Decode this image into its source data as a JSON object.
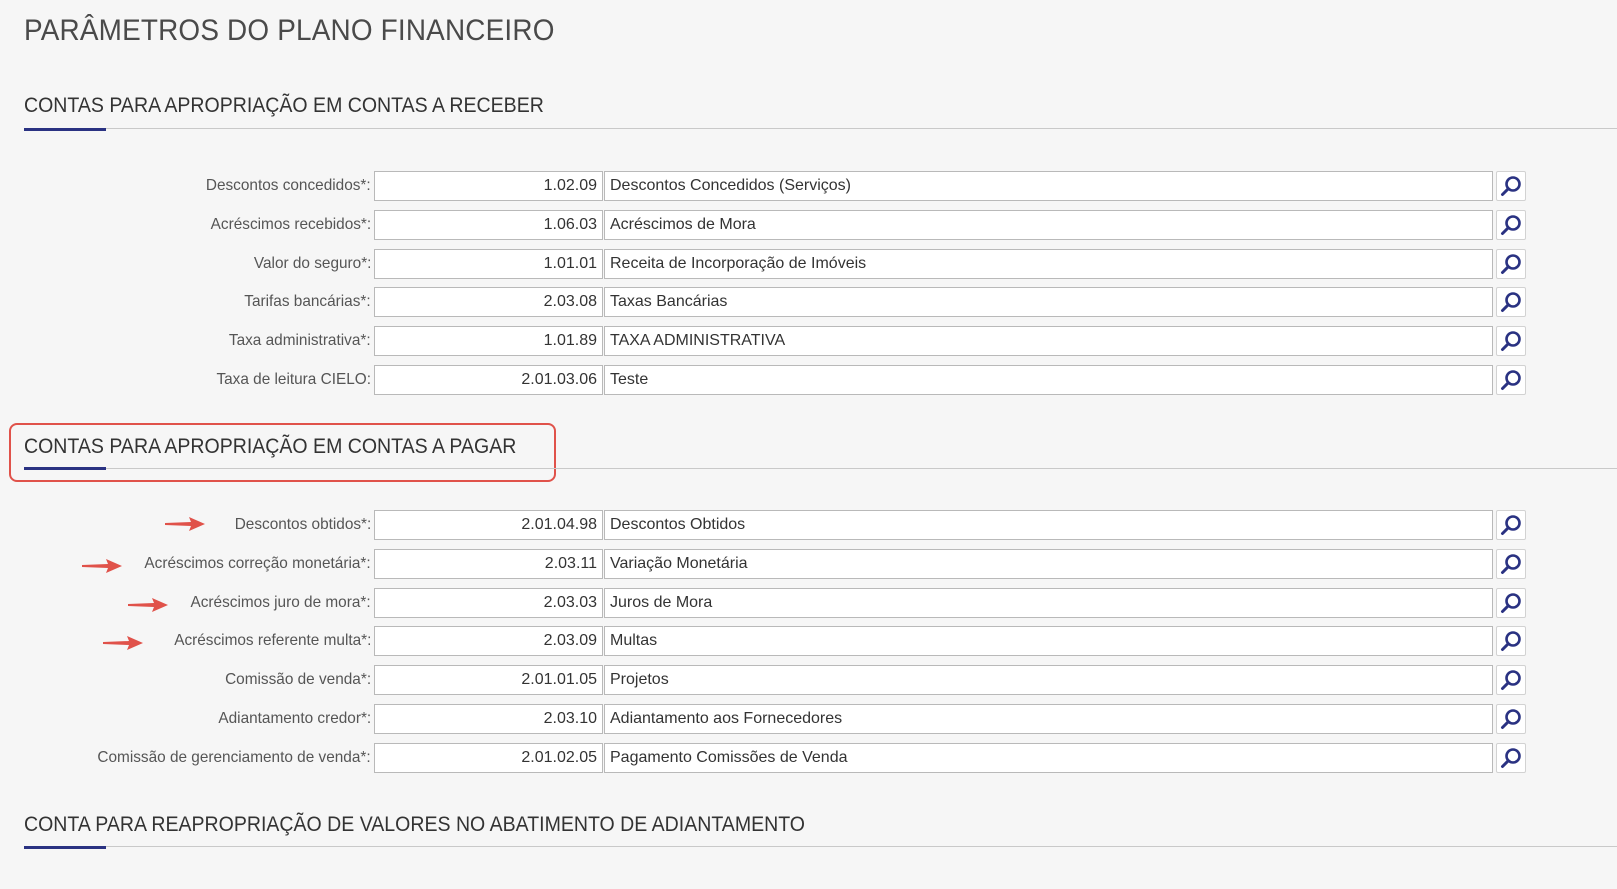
{
  "page_title": "PARÂMETROS DO PLANO FINANCEIRO",
  "colors": {
    "accent": "#2a3282",
    "highlight": "#e0524a",
    "search_icon": "#2a3282"
  },
  "sections": [
    {
      "title": "CONTAS PARA APROPRIAÇÃO EM CONTAS A RECEBER",
      "rows": [
        {
          "label": "Descontos concedidos*:",
          "code": "1.02.09",
          "description": "Descontos Concedidos (Serviços)"
        },
        {
          "label": "Acréscimos recebidos*:",
          "code": "1.06.03",
          "description": "Acréscimos de Mora"
        },
        {
          "label": "Valor do seguro*:",
          "code": "1.01.01",
          "description": "Receita de Incorporação de Imóveis"
        },
        {
          "label": "Tarifas bancárias*:",
          "code": "2.03.08",
          "description": "Taxas Bancárias"
        },
        {
          "label": "Taxa administrativa*:",
          "code": "1.01.89",
          "description": "TAXA ADMINISTRATIVA"
        },
        {
          "label": "Taxa de leitura CIELO:",
          "code": "2.01.03.06",
          "description": "Teste"
        }
      ]
    },
    {
      "title": "CONTAS PARA APROPRIAÇÃO EM CONTAS A PAGAR",
      "rows": [
        {
          "label": "Descontos obtidos*:",
          "code": "2.01.04.98",
          "description": "Descontos Obtidos"
        },
        {
          "label": "Acréscimos correção monetária*:",
          "code": "2.03.11",
          "description": "Variação Monetária"
        },
        {
          "label": "Acréscimos juro de mora*:",
          "code": "2.03.03",
          "description": "Juros de Mora"
        },
        {
          "label": "Acréscimos referente multa*:",
          "code": "2.03.09",
          "description": "Multas"
        },
        {
          "label": "Comissão de venda*:",
          "code": "2.01.01.05",
          "description": "Projetos"
        },
        {
          "label": "Adiantamento credor*:",
          "code": "2.03.10",
          "description": "Adiantamento aos Fornecedores"
        },
        {
          "label": "Comissão de gerenciamento de venda*:",
          "code": "2.01.02.05",
          "description": "Pagamento Comissões de Venda"
        }
      ]
    },
    {
      "title": "CONTA PARA REAPROPRIAÇÃO DE VALORES NO ABATIMENTO DE ADIANTAMENTO",
      "rows": []
    }
  ],
  "icons": {
    "search": "search-icon",
    "annotation_arrow": "arrow-right-icon"
  }
}
